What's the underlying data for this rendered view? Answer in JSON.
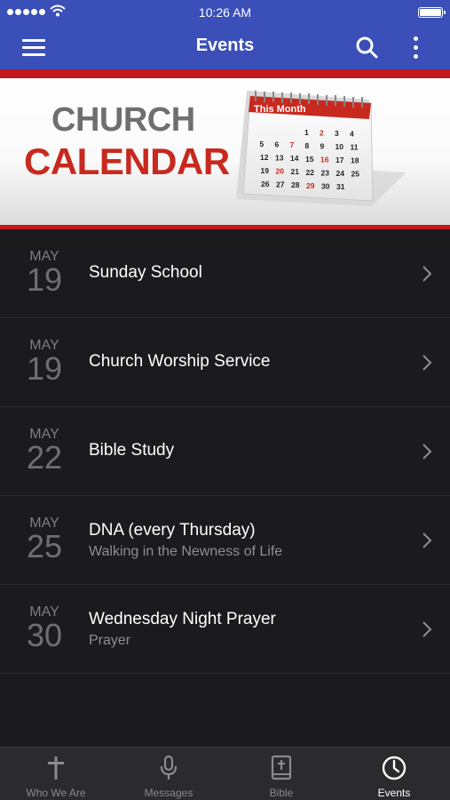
{
  "status": {
    "time": "10:26 AM"
  },
  "nav": {
    "title": "Events"
  },
  "banner": {
    "line1": "CHURCH",
    "line2": "CALENDAR",
    "calendar_header": "This Month",
    "calendar_numbers": [
      [
        "",
        "",
        "",
        "1",
        "2",
        "3",
        "4"
      ],
      [
        "5",
        "6",
        "7",
        "8",
        "9",
        "10",
        "11"
      ],
      [
        "12",
        "13",
        "14",
        "15",
        "16",
        "17",
        "18"
      ],
      [
        "19",
        "20",
        "21",
        "22",
        "23",
        "24",
        "25"
      ],
      [
        "26",
        "27",
        "28",
        "29",
        "30",
        "31",
        ""
      ]
    ]
  },
  "events": [
    {
      "month": "MAY",
      "day": "19",
      "title": "Sunday School",
      "subtitle": ""
    },
    {
      "month": "MAY",
      "day": "19",
      "title": "Church Worship Service",
      "subtitle": ""
    },
    {
      "month": "MAY",
      "day": "22",
      "title": "Bible Study",
      "subtitle": ""
    },
    {
      "month": "MAY",
      "day": "25",
      "title": "DNA (every Thursday)",
      "subtitle": "Walking in the Newness of Life"
    },
    {
      "month": "MAY",
      "day": "30",
      "title": "Wednesday Night Prayer",
      "subtitle": "Prayer"
    }
  ],
  "tabs": [
    {
      "label": "Who We Are",
      "icon": "cross-icon",
      "active": false
    },
    {
      "label": "Messages",
      "icon": "microphone-icon",
      "active": false
    },
    {
      "label": "Bible",
      "icon": "bible-icon",
      "active": false
    },
    {
      "label": "Events",
      "icon": "clock-icon",
      "active": true
    }
  ],
  "colors": {
    "nav": "#3a4fb8",
    "accent_red": "#c4161c",
    "list_bg": "#1b1b1d"
  }
}
